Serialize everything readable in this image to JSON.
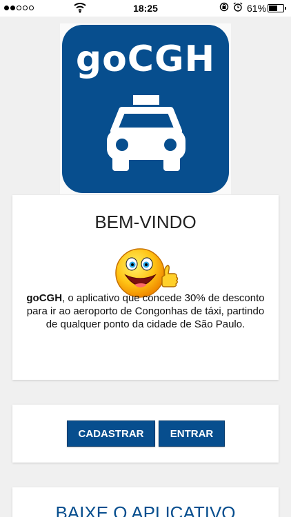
{
  "status_bar": {
    "time": "18:25",
    "battery_percent": "61%",
    "battery_level": 0.61,
    "signal_icon": "signal-dots-icon",
    "wifi_icon": "wifi-icon"
  },
  "logo": {
    "text": "goCGH",
    "icon": "taxi-icon",
    "bg_color": "#074e8e"
  },
  "welcome": {
    "title": "BEM-VINDO",
    "emoji_icon": "thumbs-up-smiley-icon",
    "brand": "goCGH",
    "description": ", o aplicativo que concede 30% de desconto para ir ao aeroporto de Congonhas de táxi, partindo de qualquer ponto da cidade de São Paulo."
  },
  "actions": {
    "register_label": "CADASTRAR",
    "login_label": "ENTRAR"
  },
  "download": {
    "title": "BAIXE O APLICATIVO"
  }
}
